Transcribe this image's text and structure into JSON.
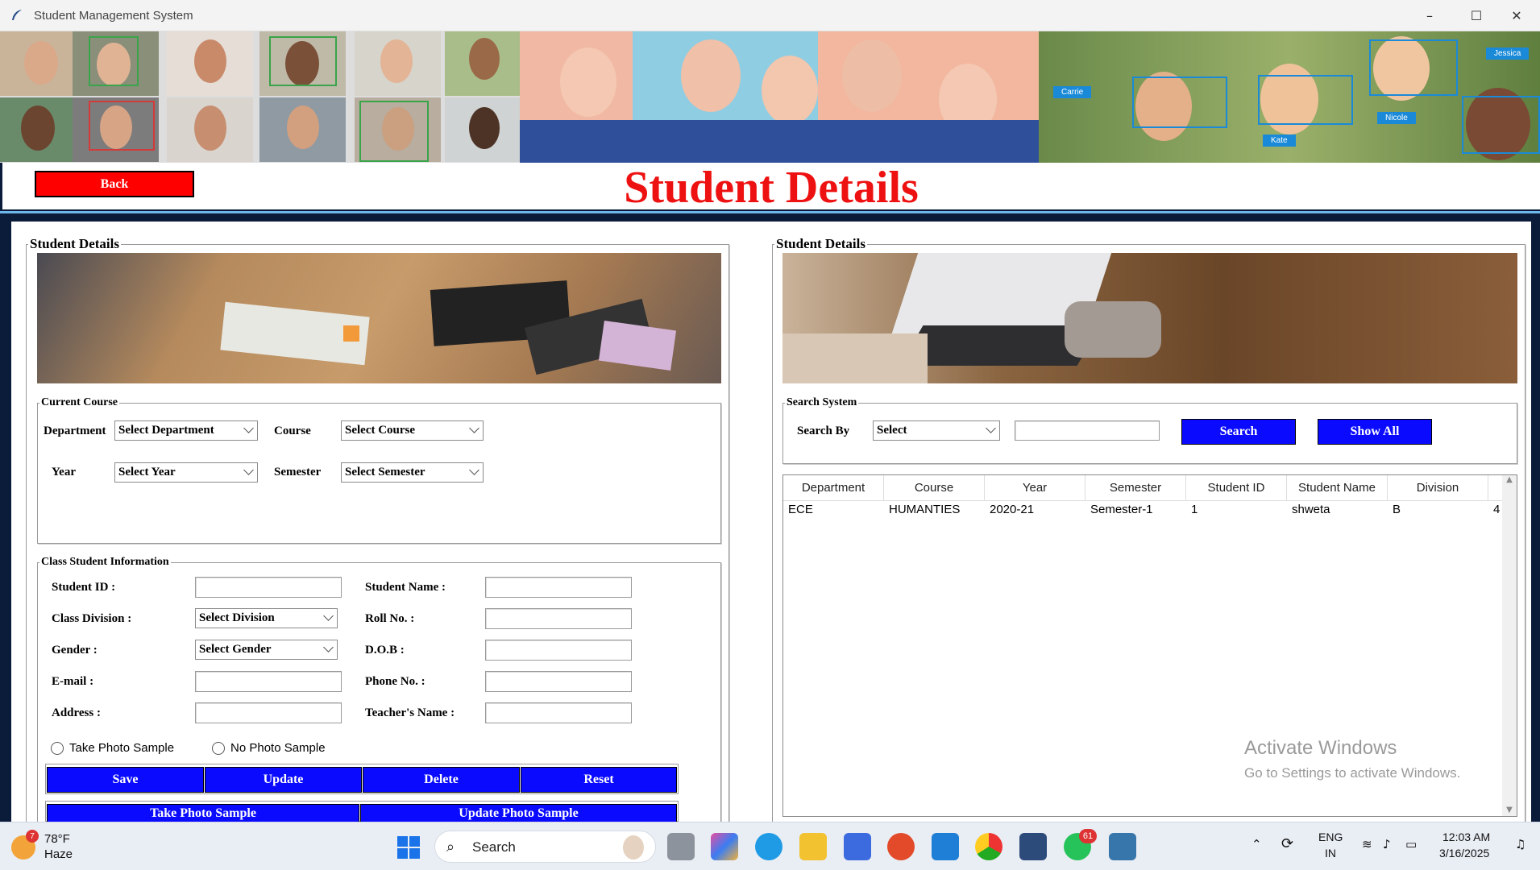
{
  "window": {
    "title": "Student Management System",
    "minimize_icon": "–",
    "maximize_icon": "☐",
    "close_icon": "✕"
  },
  "banner": {
    "face_labels": [
      "Carrie",
      "Kate",
      "Nicole",
      "Jessica"
    ]
  },
  "header": {
    "back_label": "Back",
    "page_title": "Student Details"
  },
  "left_panel": {
    "title": "Student Details",
    "current_course": {
      "title": "Current Course",
      "department_label": "Department",
      "department_value": "Select Department",
      "course_label": "Course",
      "course_value": "Select Course",
      "year_label": "Year",
      "year_value": "Select Year",
      "semester_label": "Semester",
      "semester_value": "Select Semester"
    },
    "class_info": {
      "title": "Class Student Information",
      "student_id_label": "Student ID :",
      "student_name_label": "Student Name :",
      "division_label": "Class Division :",
      "division_value": "Select Division",
      "roll_label": "Roll No. :",
      "gender_label": "Gender :",
      "gender_value": "Select Gender",
      "dob_label": "D.O.B :",
      "email_label": "E-mail :",
      "phone_label": "Phone No. :",
      "address_label": "Address :",
      "teacher_label": "Teacher's Name :",
      "radio_take": "Take Photo Sample",
      "radio_no": "No Photo Sample"
    },
    "buttons": {
      "save": "Save",
      "update": "Update",
      "delete": "Delete",
      "reset": "Reset",
      "take_photo": "Take Photo Sample",
      "update_photo": "Update Photo Sample"
    }
  },
  "right_panel": {
    "title": "Student Details",
    "search": {
      "title": "Search System",
      "search_by_label": "Search By",
      "search_by_value": "Select",
      "search_input_value": "",
      "search_button": "Search",
      "show_all_button": "Show All"
    },
    "table": {
      "columns": [
        "Department",
        "Course",
        "Year",
        "Semester",
        "Student ID",
        "Student Name",
        "Division"
      ],
      "rows": [
        [
          "ECE",
          "HUMANTIES",
          "2020-21",
          "Semester-1",
          "1",
          "shweta",
          "B",
          "4"
        ]
      ]
    }
  },
  "watermark": {
    "line1": "Activate Windows",
    "line2": "Go to Settings to activate Windows."
  },
  "taskbar": {
    "weather_temp": "78°F",
    "weather_desc": "Haze",
    "weather_badge": "7",
    "search_placeholder": "Search",
    "whatsapp_badge": "61",
    "lang_line1": "ENG",
    "lang_line2": "IN",
    "time": "12:03 AM",
    "date": "3/16/2025"
  },
  "colors": {
    "back_button": "#ff0000",
    "title_red": "#ee1111",
    "action_blue": "#0a0aff"
  }
}
